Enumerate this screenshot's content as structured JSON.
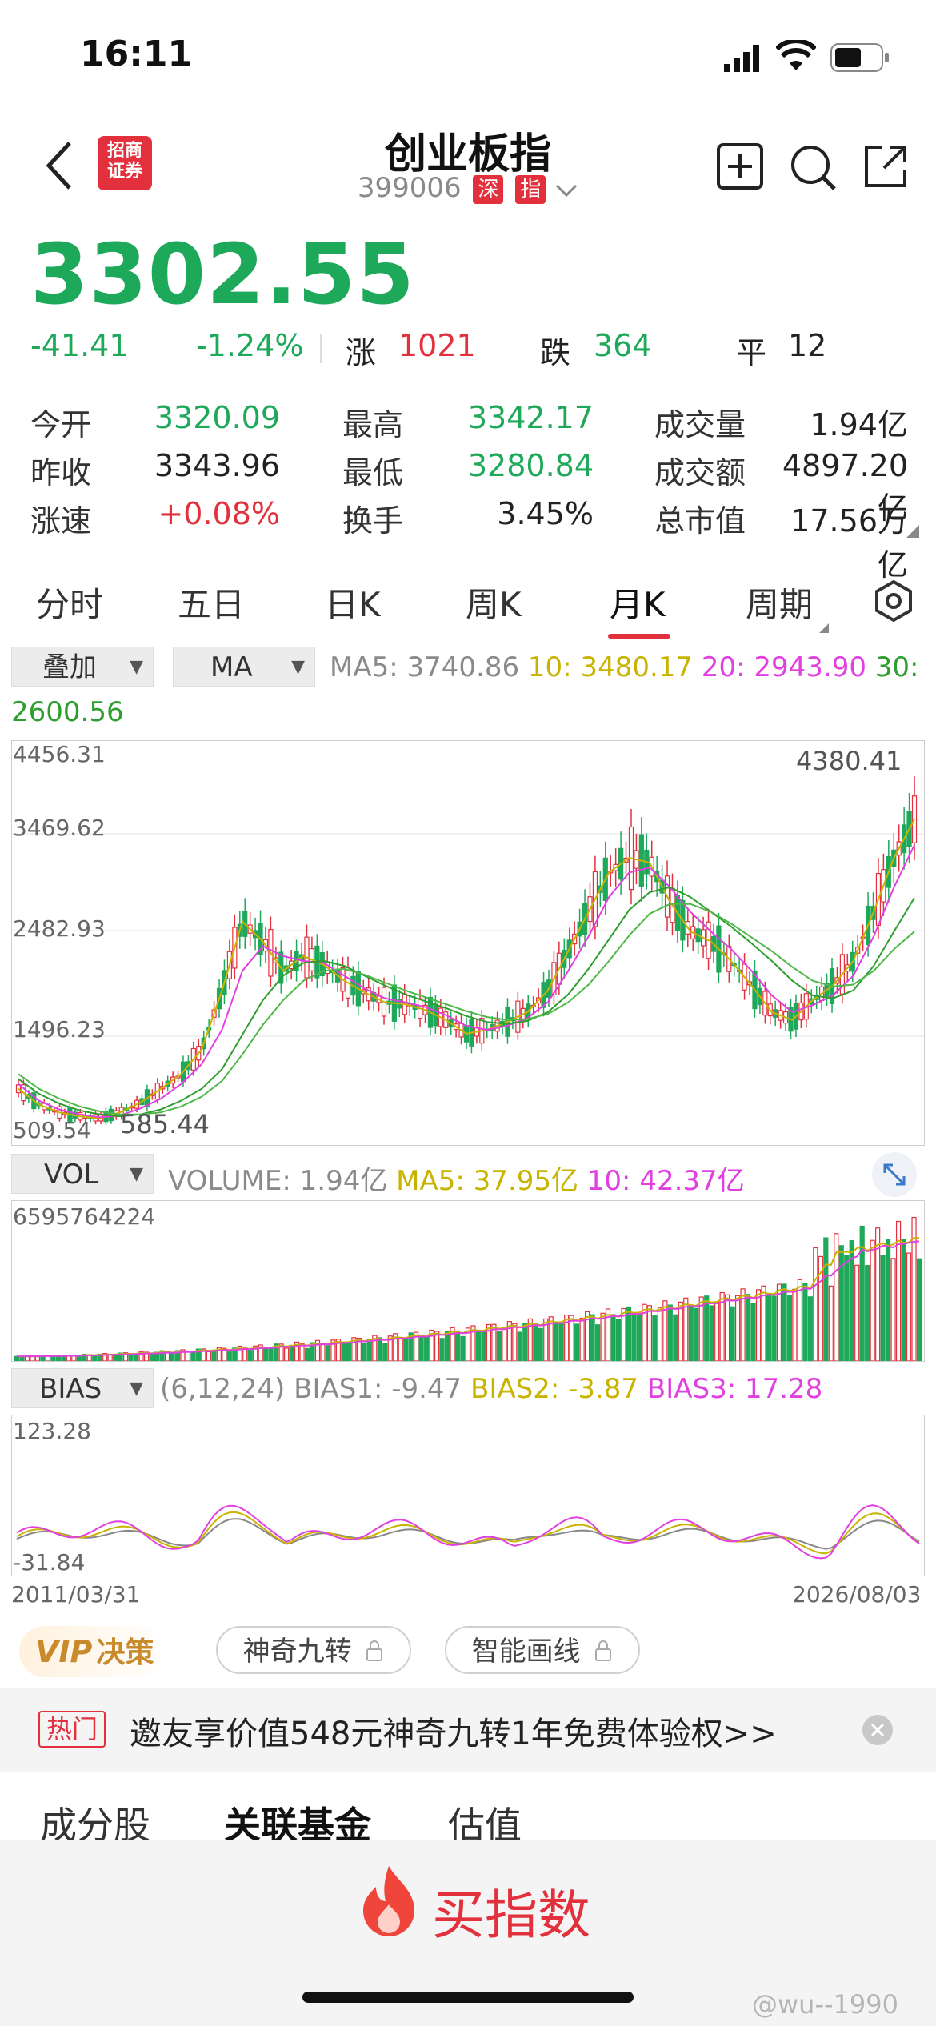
{
  "status": {
    "time": "16:11"
  },
  "header": {
    "title": "创业板指",
    "code": "399006",
    "tag_market": "深",
    "tag_type": "指",
    "app_logo_text": "招商\n证券"
  },
  "quote": {
    "price": "3302.55",
    "change": "-41.41",
    "change_pct": "-1.24%",
    "rise_label": "涨",
    "rise_count": "1021",
    "fall_label": "跌",
    "fall_count": "364",
    "flat_label": "平",
    "flat_count": "12"
  },
  "stats": [
    {
      "label": "今开",
      "value": "3320.09",
      "color": "green"
    },
    {
      "label": "最高",
      "value": "3342.17",
      "color": "green"
    },
    {
      "label": "成交量",
      "value": "1.94亿",
      "color": "dark"
    },
    {
      "label": "昨收",
      "value": "3343.96",
      "color": "dark"
    },
    {
      "label": "最低",
      "value": "3280.84",
      "color": "green"
    },
    {
      "label": "成交额",
      "value": "4897.20亿",
      "color": "dark"
    },
    {
      "label": "涨速",
      "value": "+0.08%",
      "color": "red"
    },
    {
      "label": "换手",
      "value": "3.45%",
      "color": "dark"
    },
    {
      "label": "总市值",
      "value": "17.56万亿",
      "color": "dark"
    }
  ],
  "tabs": [
    "分时",
    "五日",
    "日K",
    "周K",
    "月K",
    "周期"
  ],
  "selected_tab": "月K",
  "main_chart": {
    "overlay_selector": "叠加",
    "ma_selector": "MA",
    "ma5": "MA5: 3740.86",
    "ma10": "10: 3480.17",
    "ma20": "20: 2943.90",
    "ma30": "30:",
    "ma30_value": "2600.56",
    "y_ticks": [
      "4456.31",
      "3469.62",
      "2482.93",
      "1496.23",
      "509.54"
    ],
    "high_label": "4380.41",
    "low_label": "585.44"
  },
  "volume_chart": {
    "selector": "VOL",
    "volume": "VOLUME: 1.94亿",
    "ma5": "MA5: 37.95亿",
    "ma10": "10: 42.37亿",
    "y_max": "6595764224"
  },
  "bias_chart": {
    "selector": "BIAS",
    "params": "(6,12,24)",
    "bias1": "BIAS1: -9.47",
    "bias2": "BIAS2: -3.87",
    "bias3": "BIAS3: 17.28",
    "y_max": "123.28",
    "y_min": "-31.84",
    "date_start": "2011/03/31",
    "date_end": "2026/08/03"
  },
  "tools": {
    "vip_label": "VIP",
    "vip_suffix": "决策",
    "pill1": "神奇九转",
    "pill2": "智能画线"
  },
  "hot": {
    "badge": "热门",
    "text": "邀友享价值548元神奇九转1年免费体验权>>"
  },
  "bottom_tabs": [
    "成分股",
    "关联基金",
    "估值"
  ],
  "buy_button": "买指数",
  "watermark": "@wu--1990",
  "colors": {
    "up": "#e2313d",
    "down": "#1ea85a",
    "ma5": "#c8b400",
    "ma10": "#e040e0",
    "ma20": "#2e9e2e",
    "ma30": "#4fb848"
  },
  "chart_data": {
    "type": "candlestick",
    "series": [
      {
        "name": "MA5",
        "values": [
          1000,
          840,
          760,
          720,
          700,
          760,
          860,
          1000,
          1150,
          1400,
          2000,
          2700,
          2500,
          2200,
          2350,
          2260,
          2100,
          1980,
          1880,
          1860,
          1800,
          1700,
          1560,
          1600,
          1680,
          1780,
          2000,
          2400,
          2800,
          3200,
          3350,
          3300,
          2900,
          2600,
          2500,
          2300,
          2050,
          1780,
          1700,
          1900,
          2050,
          2300,
          2800,
          3350,
          3740
        ]
      },
      {
        "name": "10",
        "values": [
          1050,
          880,
          790,
          740,
          710,
          730,
          800,
          900,
          1050,
          1250,
          1600,
          2200,
          2450,
          2350,
          2300,
          2280,
          2150,
          2020,
          1920,
          1880,
          1830,
          1750,
          1640,
          1600,
          1640,
          1720,
          1880,
          2200,
          2550,
          2950,
          3200,
          3250,
          3050,
          2800,
          2600,
          2420,
          2200,
          1950,
          1780,
          1850,
          1950,
          2150,
          2550,
          3050,
          3480
        ]
      },
      {
        "name": "20",
        "values": [
          1100,
          950,
          850,
          780,
          740,
          720,
          740,
          790,
          880,
          1000,
          1200,
          1550,
          1900,
          2150,
          2280,
          2300,
          2250,
          2150,
          2050,
          1960,
          1890,
          1820,
          1740,
          1680,
          1660,
          1690,
          1780,
          1960,
          2220,
          2520,
          2820,
          3000,
          3050,
          2950,
          2800,
          2650,
          2480,
          2300,
          2100,
          1950,
          1920,
          2000,
          2250,
          2600,
          2943
        ]
      },
      {
        "name": "30",
        "values": [
          1150,
          1000,
          900,
          820,
          770,
          740,
          740,
          760,
          820,
          920,
          1080,
          1350,
          1650,
          1900,
          2100,
          2200,
          2220,
          2160,
          2080,
          2000,
          1930,
          1860,
          1790,
          1730,
          1700,
          1710,
          1760,
          1880,
          2060,
          2300,
          2560,
          2780,
          2880,
          2880,
          2800,
          2680,
          2540,
          2400,
          2240,
          2100,
          2040,
          2060,
          2200,
          2420,
          2600
        ]
      }
    ]
  }
}
